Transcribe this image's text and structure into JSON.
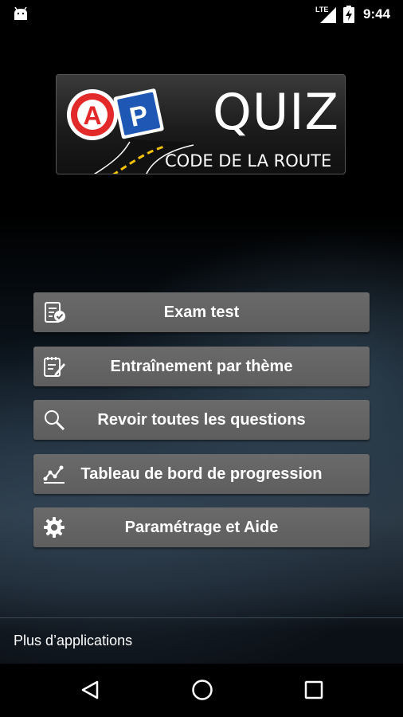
{
  "status_bar": {
    "network_label": "LTE",
    "time": "9:44",
    "icons": [
      "android-icon",
      "signal-icon",
      "battery-charging-icon"
    ]
  },
  "logo": {
    "badge_a": "A",
    "badge_p": "P",
    "title": "QUIZ",
    "subtitle": "CODE DE LA ROUTE"
  },
  "menu": {
    "items": [
      {
        "label": "Exam test",
        "icon": "exam-checklist-icon"
      },
      {
        "label": "Entraînement par thème",
        "icon": "notepad-edit-icon"
      },
      {
        "label": "Revoir toutes les questions",
        "icon": "search-icon"
      },
      {
        "label": "Tableau de bord de progression",
        "icon": "progress-chart-icon"
      },
      {
        "label": "Paramétrage et Aide",
        "icon": "gear-icon"
      }
    ]
  },
  "footer": {
    "more_apps_label": "Plus d’applications"
  },
  "nav_bar": {
    "icons": [
      "back-icon",
      "home-icon",
      "recent-apps-icon"
    ]
  },
  "colors": {
    "button_bg": "#5f5f5f",
    "badge_red": "#e32a2a",
    "badge_blue": "#1f57b5",
    "background": "#000000"
  }
}
